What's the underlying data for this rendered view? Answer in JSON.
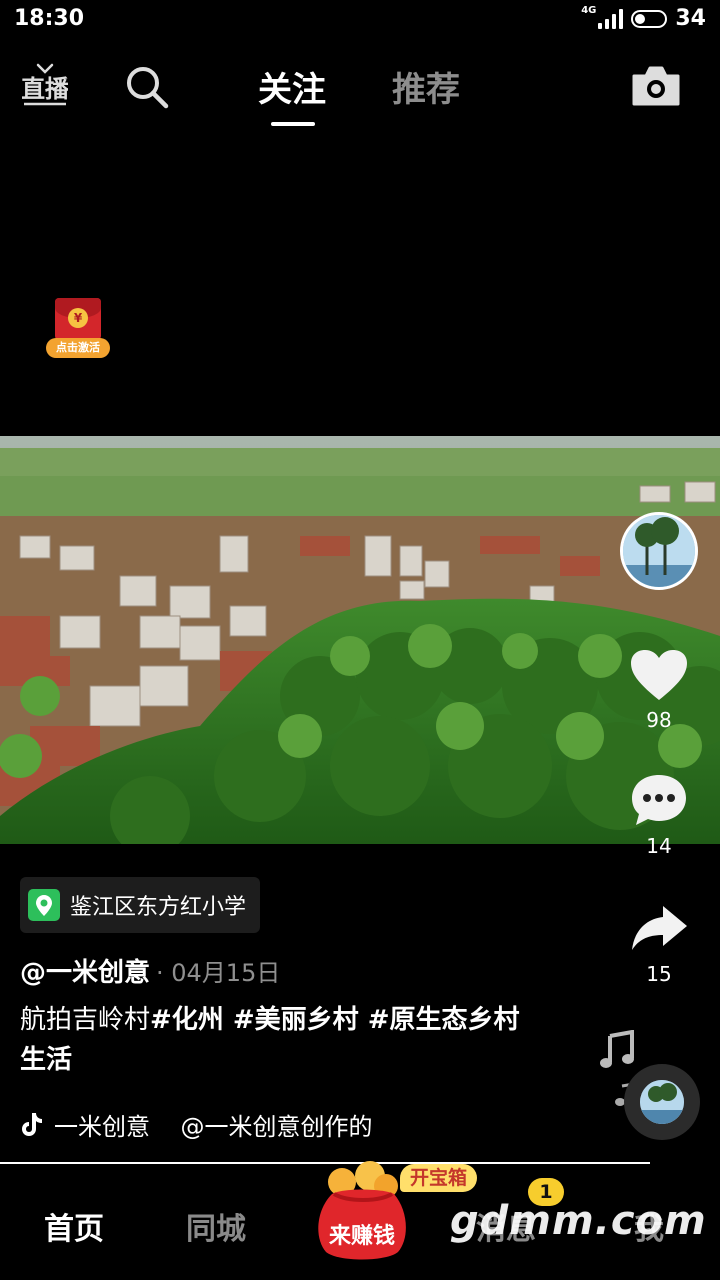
{
  "status_bar": {
    "time": "18:30",
    "network": "4G",
    "battery": "34",
    "battery_fraction": 0.34
  },
  "top_nav": {
    "live_icon": "live-broadcast-icon",
    "search_icon": "search-icon",
    "tabs": [
      {
        "label": "关注",
        "active": true
      },
      {
        "label": "推荐",
        "active": false
      }
    ],
    "camera_icon": "camera-icon"
  },
  "red_packet": {
    "label": "点击激活",
    "coin": "¥"
  },
  "video": {
    "content": "aerial-village-landscape"
  },
  "right_rail": {
    "avatar_icon": "author-avatar",
    "like_count": "98",
    "comment_count": "14",
    "share_count": "15"
  },
  "post": {
    "location": "鉴江区东方红小学",
    "author": "@一米创意",
    "date": "· 04月15日",
    "caption_plain": "航拍吉岭村",
    "caption_tags": "#化州 #美丽乡村 #原生态乡村生活",
    "music_title": "一米创意    @一米创意创作的"
  },
  "bottom_nav": {
    "home": "首页",
    "city": "同城",
    "earn": "来赚钱",
    "chest_badge": "开宝箱",
    "messages": "消息",
    "messages_badge": "1",
    "me": "我"
  },
  "watermark": "gdmm.com",
  "colors": {
    "background": "#000000",
    "inactive_text": "#8a8a8a",
    "badge_yellow": "#f7cd2d",
    "red_packet": "#d3262b"
  }
}
